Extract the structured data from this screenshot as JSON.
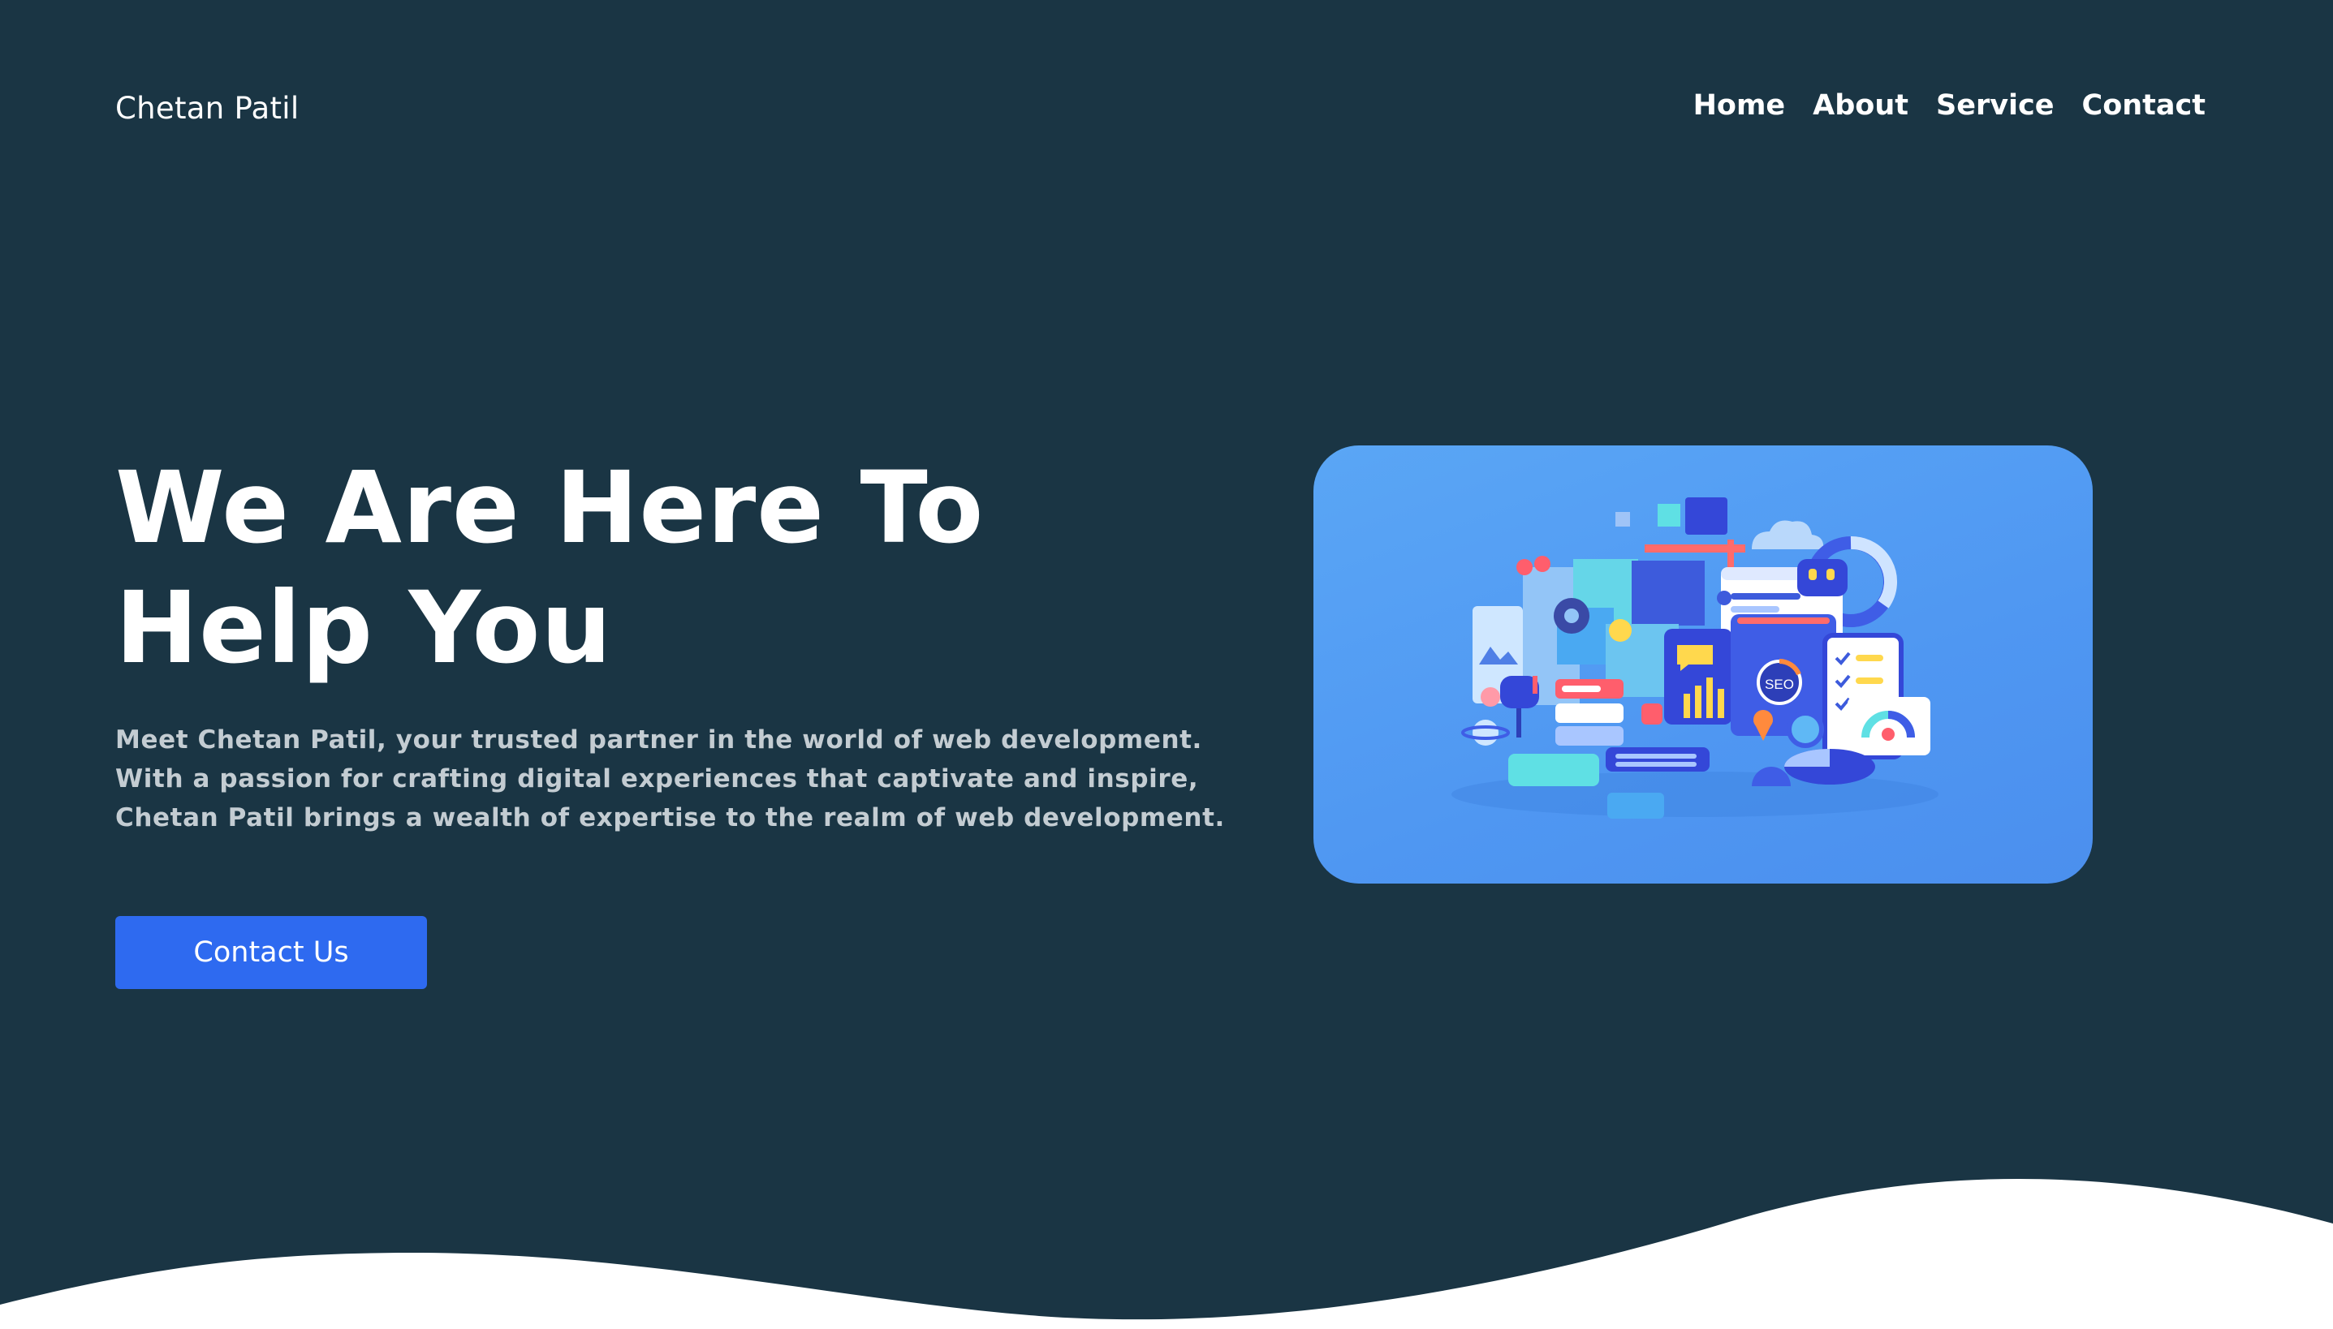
{
  "header": {
    "brand": "Chetan Patil",
    "nav": [
      {
        "label": "Home"
      },
      {
        "label": "About"
      },
      {
        "label": "Service"
      },
      {
        "label": "Contact"
      }
    ]
  },
  "hero": {
    "title_lines": [
      "We Are Here To",
      "Help You"
    ],
    "description_lines": [
      "Meet Chetan Patil, your trusted partner in the world of web development.",
      "With a passion for crafting digital experiences that captivate and inspire,",
      "Chetan Patil brings a wealth of expertise to the realm of web development."
    ],
    "cta_label": "Contact Us"
  },
  "illustration": {
    "badge_text": "SEO",
    "icon": "web-development-illustration"
  },
  "colors": {
    "background": "#1a3544",
    "accent": "#2e6af0",
    "illustration_bg": "#5aa6f5",
    "wave": "#ffffff"
  }
}
